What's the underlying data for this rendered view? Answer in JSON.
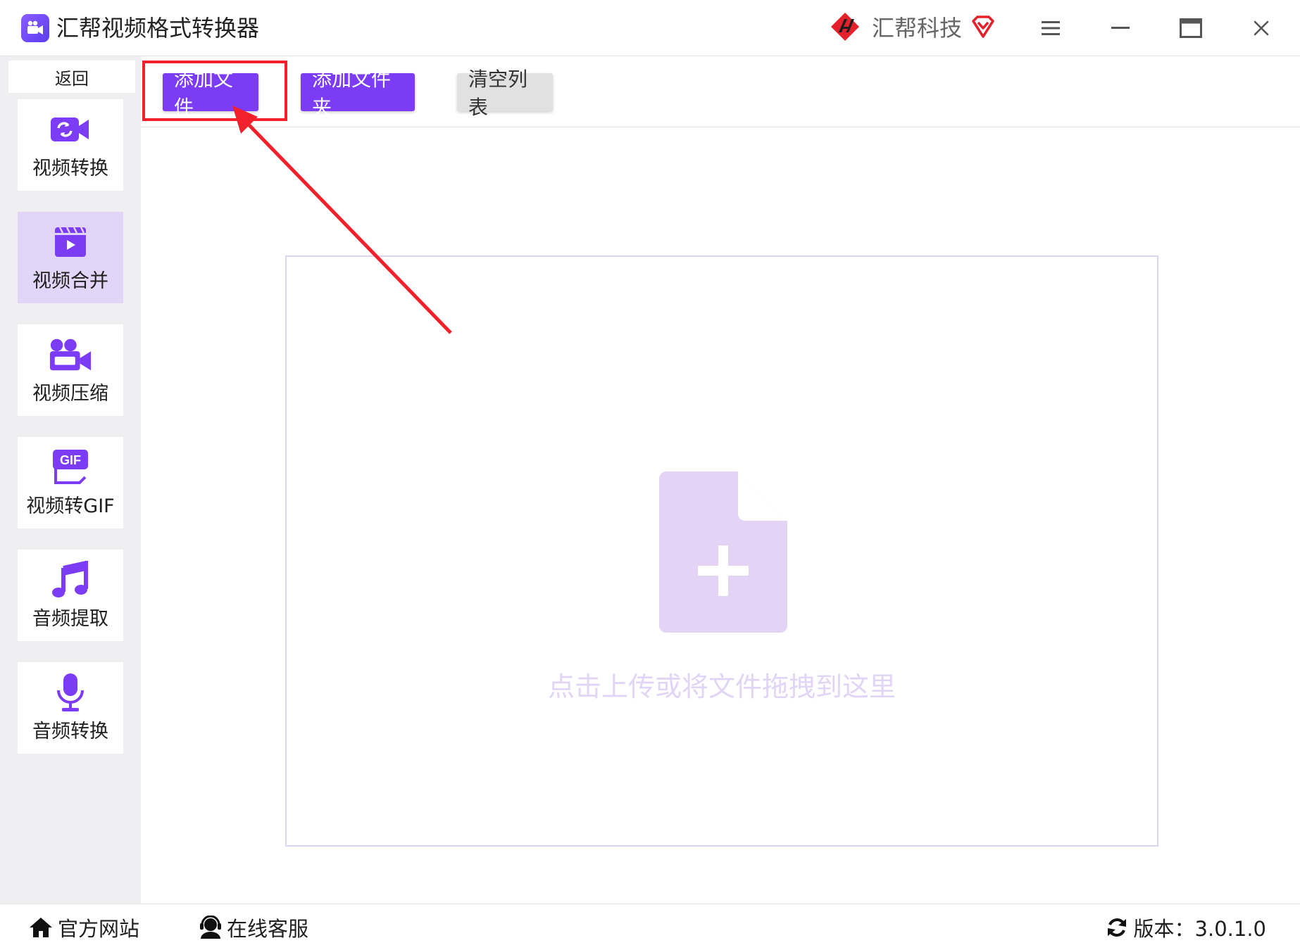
{
  "window": {
    "title": "汇帮视频格式转换器",
    "brand": "汇帮科技"
  },
  "sidebar": {
    "back_label": "返回",
    "items": [
      {
        "label": "视频转换",
        "icon": "video-convert-icon",
        "active": false
      },
      {
        "label": "视频合并",
        "icon": "video-merge-icon",
        "active": true
      },
      {
        "label": "视频压缩",
        "icon": "video-compress-icon",
        "active": false
      },
      {
        "label": "视频转GIF",
        "icon": "gif-icon",
        "active": false
      },
      {
        "label": "音频提取",
        "icon": "music-note-icon",
        "active": false
      },
      {
        "label": "音频转换",
        "icon": "microphone-icon",
        "active": false
      }
    ]
  },
  "toolbar": {
    "add_file": "添加文件",
    "add_folder": "添加文件夹",
    "clear_list": "清空列表"
  },
  "dropzone": {
    "hint": "点击上传或将文件拖拽到这里"
  },
  "footer": {
    "website": "官方网站",
    "support": "在线客服",
    "version": "版本：3.0.1.0"
  },
  "colors": {
    "accent": "#7c3cf5",
    "active_nav": "#e2d5f8",
    "annotation": "#f2202b",
    "dropzone_icon": "#e3d4f6"
  }
}
